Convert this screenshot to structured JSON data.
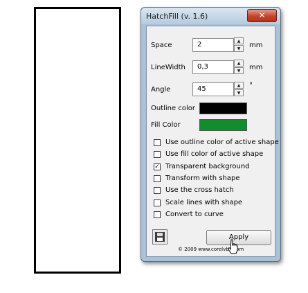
{
  "window": {
    "title": "HatchFill (v. 1.6)",
    "close_icon": "close-icon"
  },
  "fields": {
    "space": {
      "label": "Space",
      "value": "2",
      "unit": "mm"
    },
    "linewidth": {
      "label": "LineWidth",
      "value": "0,3",
      "unit": "mm"
    },
    "angle": {
      "label": "Angle",
      "value": "45",
      "unit": "°"
    }
  },
  "colors": {
    "outline": {
      "label": "Outline color",
      "value": "#000000"
    },
    "fill": {
      "label": "Fill Color",
      "value": "#128c2e"
    }
  },
  "options": [
    {
      "label": "Use outline color of active shape",
      "checked": false
    },
    {
      "label": "Use fill color of active shape",
      "checked": false
    },
    {
      "label": "Transparent background",
      "checked": true
    },
    {
      "label": "Transform with shape",
      "checked": false
    },
    {
      "label": "Use the cross hatch",
      "checked": false
    },
    {
      "label": "Scale lines with shape",
      "checked": false
    },
    {
      "label": "Convert to curve",
      "checked": false
    }
  ],
  "footer": {
    "save_icon": "save-icon",
    "apply_label": "Apply",
    "copyright": "©  2009 www.corelvba.com"
  }
}
